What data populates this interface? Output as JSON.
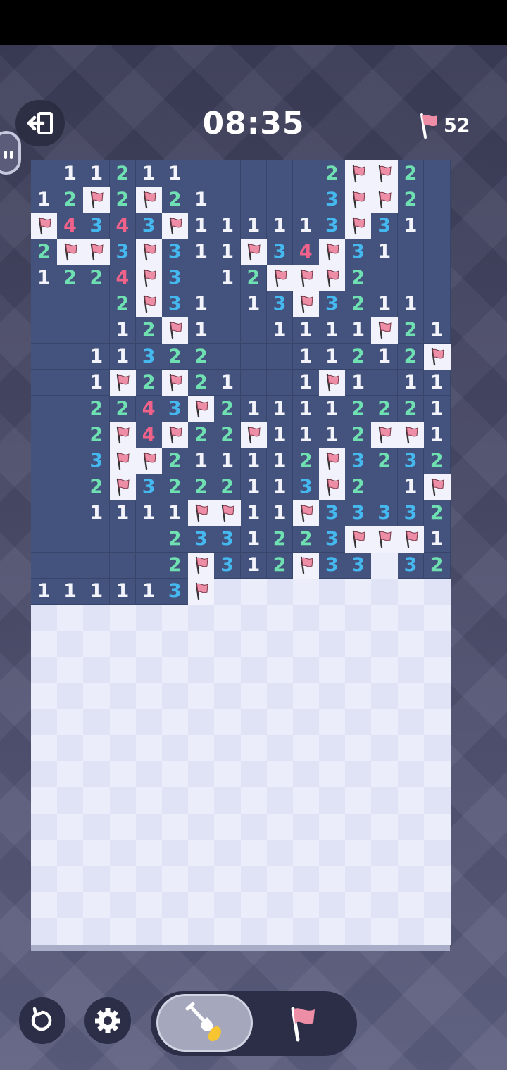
{
  "header": {
    "timer": "08:35",
    "flags_remaining": "52",
    "exit_icon": "exit-icon",
    "flag_icon": "flag-icon"
  },
  "board": {
    "columns": 16,
    "rows": 30,
    "legend": "'.' = revealed empty, digits = adjacent mine count, F = flagged, '#' = unrevealed",
    "grid": [
      ". . 1 1 2 1 1 . . . . . 2 F F 2 .",
      "1 2 F 2 F 2 1 . . . . 3 F F 2 .",
      "F 4 3 4 3 F 1 1 1 1 1 3 F 3 1 .",
      "2 F F 3 F 3 1 1 F 3 4 F 3 1 . .",
      "1 2 2 4 F 3 . 1 2 F F F 2 . . .",
      ". . . 2 F 3 1 . 1 3 F 3 2 1 1 .",
      ". . . 1 2 F 1 . . 1 1 1 1 F 2 1",
      ". . 1 1 3 2 2 . . . 1 1 2 1 2 F",
      ". . 1 F 2 F 2 1 . . 1 F 1 . 1 1",
      ". . 2 2 4 3 F 2 1 1 1 1 2 2 2 1",
      ". . 2 F 4 F 2 2 F 1 1 1 2 F F 1",
      ". . 3 F F 2 1 1 1 1 2 F 3 2 3 2",
      ". . 2 F 3 2 2 2 1 1 3 F 2 . 1 F",
      ". . 1 1 1 1 F F 1 1 F 3 3 3 3 2",
      ". . . . . 2 3 3 1 2 2 3 F F F 1",
      ". . . . . 2 F 3 1 2 F 3 3 # 3 2",
      "1 1 1 1 1 3 F # # # # # # # # #",
      "# # # # # # # # # # # # # # # #",
      "# # # # # # # # # # # # # # # #",
      "# # # # # # # # # # # # # # # #",
      "# # # # # # # # # # # # # # # #",
      "# # # # # # # # # # # # # # # #",
      "# # # # # # # # # # # # # # # #",
      "# # # # # # # # # # # # # # # #",
      "# # # # # # # # # # # # # # # #",
      "# # # # # # # # # # # # # # # #",
      "# # # # # # # # # # # # # # # #",
      "# # # # # # # # # # # # # # # #",
      "# # # # # # # # # # # # # # # #",
      "# # # # # # # # # # # # # # # #"
    ],
    "number_colors": {
      "1": "#f3f4fb",
      "2": "#6fe0b1",
      "3": "#45b8ef",
      "4": "#f0628a"
    },
    "revealed_color": "#44537d",
    "flag_color": "#ee8ea6"
  },
  "controls": {
    "restart_icon": "restart-icon",
    "settings_icon": "gear-icon",
    "mode_dig_icon": "shovel-icon",
    "mode_flag_icon": "flag-icon",
    "active_mode": "dig"
  }
}
